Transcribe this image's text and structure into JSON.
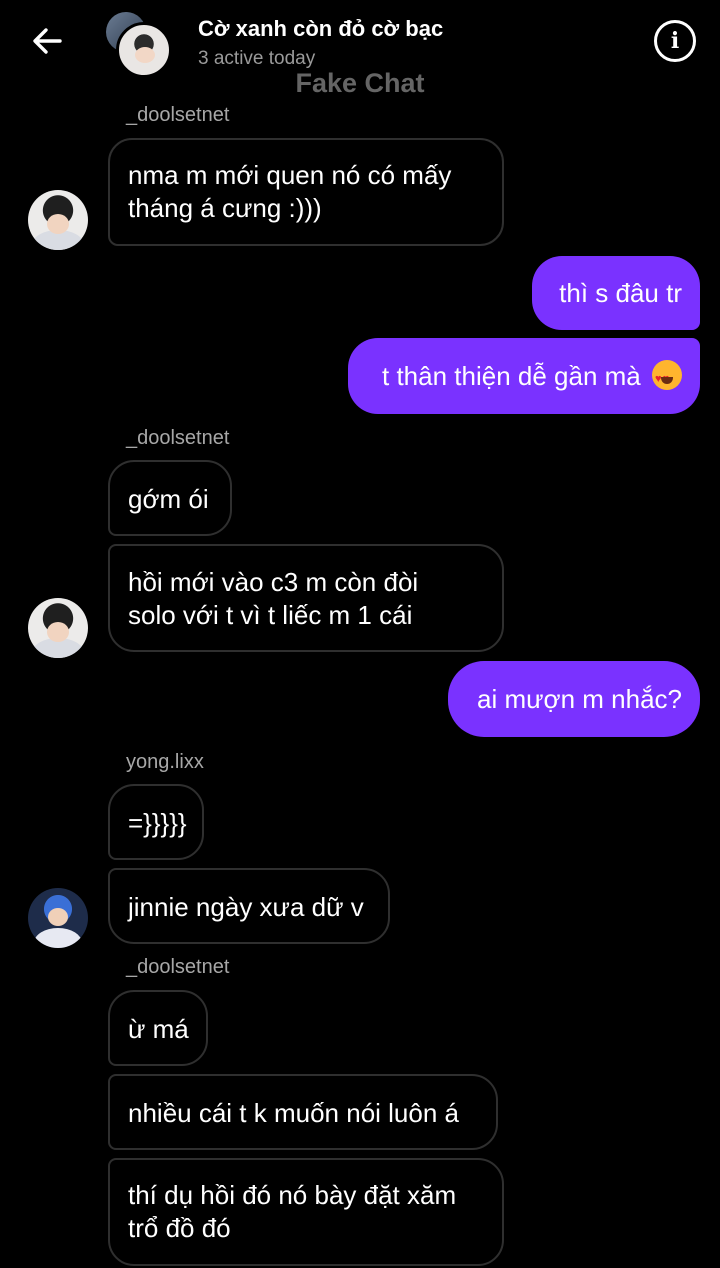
{
  "header": {
    "back_icon": "arrow-left-icon",
    "title": "Cờ xanh còn đỏ cờ bạc",
    "subtitle": "3 active today",
    "info_icon": "info-icon",
    "info_label": "i",
    "watermark": "Fake Chat"
  },
  "messages": [
    {
      "sender": "_doolsetnet"
    },
    {
      "text_line1": "nma m mới quen nó có mấy",
      "text_line2": "tháng á cưng :)))"
    },
    {
      "text": "thì s đâu tr"
    },
    {
      "text": "t thân thiện dễ gần mà",
      "emoji": "heart-eyes-emoji"
    },
    {
      "sender": "_doolsetnet"
    },
    {
      "text": "gớm ói"
    },
    {
      "text_line1": "hồi mới vào c3 m còn đòi",
      "text_line2": "solo với t vì t liếc m 1 cái"
    },
    {
      "text": "ai mượn m nhắc?"
    },
    {
      "sender": "yong.lixx"
    },
    {
      "text": "=}}}}}"
    },
    {
      "text": "jinnie ngày xưa dữ v"
    },
    {
      "sender": "_doolsetnet"
    },
    {
      "text": "ừ má"
    },
    {
      "text": "nhiều cái t k muốn nói luôn á"
    },
    {
      "text_line1": "thí dụ hồi đó nó bày đặt xăm",
      "text_line2": "trổ đồ đó"
    }
  ],
  "colors": {
    "background": "#000000",
    "outgoing_bubble": "#7a32ff",
    "incoming_border": "#2f2f2f",
    "secondary_text": "#9a9a9a"
  }
}
